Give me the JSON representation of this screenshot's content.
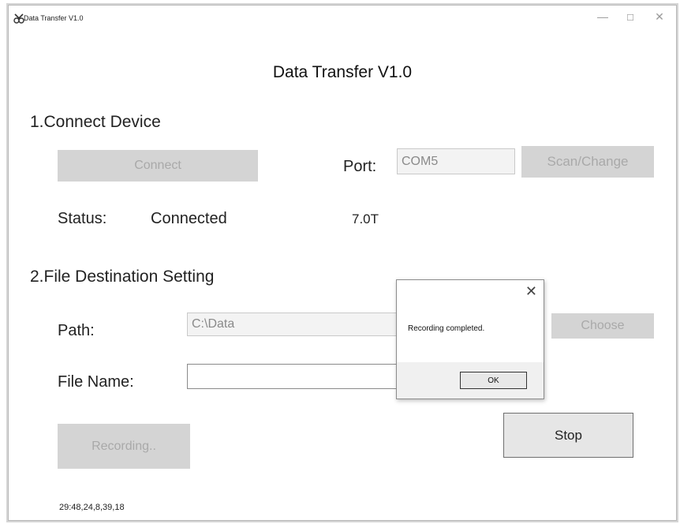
{
  "window": {
    "title": "Data Transfer V1.0",
    "minimize": "—",
    "maximize": "☐",
    "close": "✕"
  },
  "heading": "Data Transfer V1.0",
  "connect_section": {
    "title": "1.Connect Device",
    "connect_button": "Connect",
    "port_label": "Port:",
    "port_value": "COM5",
    "scan_button": "Scan/Change",
    "status_label": "Status:",
    "status_value": "Connected",
    "field_strength": "7.0T"
  },
  "file_section": {
    "title": "2.File Destination Setting",
    "path_label": "Path:",
    "path_value": "C:\\Data",
    "choose_button": "Choose",
    "filename_label": "File Name:",
    "filename_value": ""
  },
  "recording_button": "Recording..",
  "stop_button": "Stop",
  "footer_text": "29:48,24,8,39,18",
  "dialog": {
    "close": "✕",
    "message": "Recording completed.",
    "ok_button": "OK"
  }
}
